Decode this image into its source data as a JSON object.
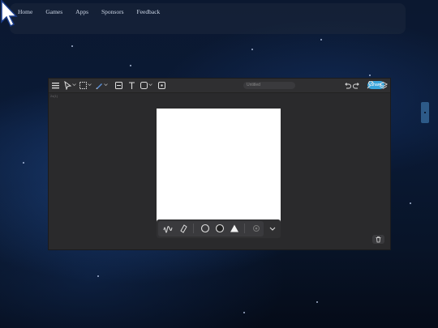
{
  "nav": {
    "links": [
      "Home",
      "Games",
      "Apps",
      "Sponsors",
      "Feedback"
    ]
  },
  "editor": {
    "zoom_label": "2x(1)",
    "title_placeholder": "Untitled",
    "share_label": "Share",
    "toolbar_icons": [
      "menu-icon",
      "select-icon",
      "lasso-select-icon",
      "pen-icon",
      "image-icon",
      "text-icon",
      "shape-icon",
      "ai-icon",
      "undo-icon",
      "redo-icon",
      "settings-icon",
      "layers-icon"
    ],
    "bottom_tools": [
      "scribble-icon",
      "eraser-icon",
      "circle-outline-icon",
      "circle-filled-icon",
      "triangle-icon",
      "gear-icon",
      "chevron-down-icon"
    ]
  },
  "colors": {
    "accent": "#3aa6dc",
    "canvas": "#ffffff",
    "panel": "#2a2a2c"
  }
}
